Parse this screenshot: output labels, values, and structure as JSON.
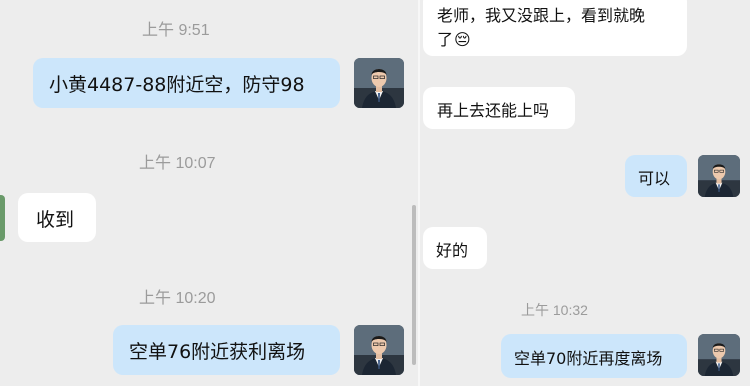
{
  "left": {
    "timestamps": [
      "上午 9:51",
      "上午 10:07",
      "上午 10:20"
    ],
    "messages": [
      {
        "from": "me",
        "text": "小黄4487-88附近空，防守98"
      },
      {
        "from": "them",
        "text": "收到"
      },
      {
        "from": "me",
        "text": "空单76附近获利离场"
      }
    ]
  },
  "right": {
    "messages_top": [
      {
        "from": "them",
        "line1": "老师，我又没跟上，看到就晚",
        "line2": "了"
      },
      {
        "from": "them",
        "text": "再上去还能上吗"
      },
      {
        "from": "me",
        "text": "可以"
      },
      {
        "from": "them",
        "text": "好的"
      }
    ],
    "timestamp": "上午 10:32",
    "message_bottom": {
      "from": "me",
      "text": "空单70附近再度离场"
    },
    "emoji": "😔"
  },
  "colors": {
    "background": "#ededed",
    "my_bubble": "#cce6fb",
    "their_bubble": "#ffffff",
    "timestamp": "#9b9b9b"
  },
  "icons": {
    "avatar": "profile-photo-man-suit",
    "emoji": "pensive-face"
  }
}
